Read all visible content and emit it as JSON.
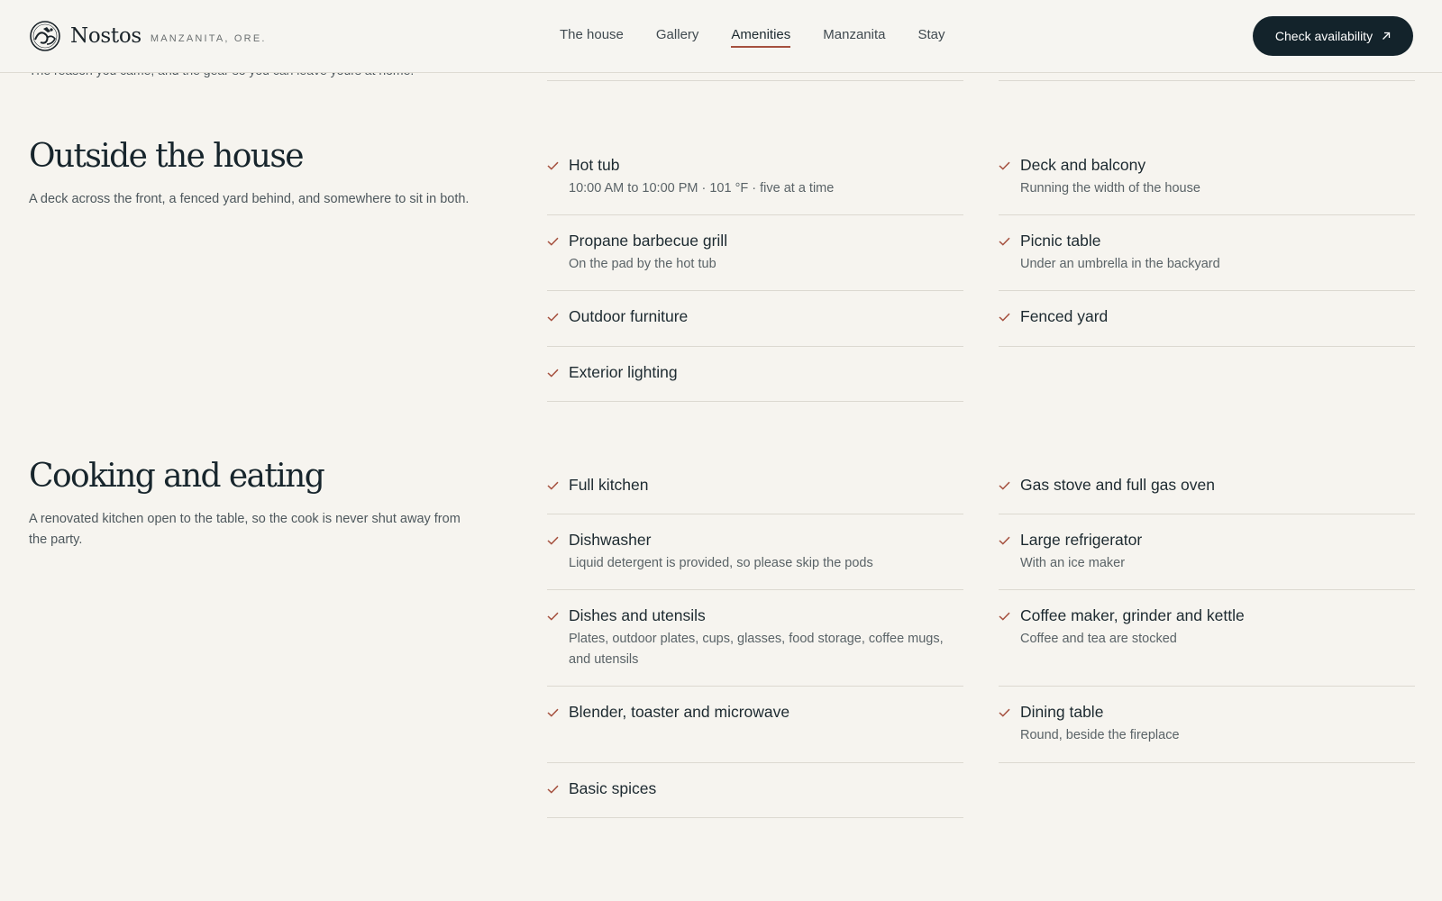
{
  "header": {
    "brand_name": "Nostos",
    "brand_location": "MANZANITA, ORE.",
    "nav": [
      "The house",
      "Gallery",
      "Amenities",
      "Manzanita",
      "Stay"
    ],
    "active_nav": "Amenities",
    "cta_label": "Check availability"
  },
  "previous_section": {
    "description": "The reason you came, and the gear so you can leave yours at home."
  },
  "sections": [
    {
      "title": "Outside the house",
      "description": "A deck across the front, a fenced yard behind, and somewhere to sit in both.",
      "left": [
        {
          "title": "Hot tub",
          "sub": "10:00 AM to 10:00 PM · 101 °F · five at a time"
        },
        {
          "title": "Propane barbecue grill",
          "sub": "On the pad by the hot tub"
        },
        {
          "title": "Outdoor furniture",
          "sub": ""
        },
        {
          "title": "Exterior lighting",
          "sub": ""
        }
      ],
      "right": [
        {
          "title": "Deck and balcony",
          "sub": "Running the width of the house"
        },
        {
          "title": "Picnic table",
          "sub": "Under an umbrella in the backyard"
        },
        {
          "title": "Fenced yard",
          "sub": ""
        }
      ]
    },
    {
      "title": "Cooking and eating",
      "description": "A renovated kitchen open to the table, so the cook is never shut away from the party.",
      "left": [
        {
          "title": "Full kitchen",
          "sub": ""
        },
        {
          "title": "Dishwasher",
          "sub": "Liquid detergent is provided, so please skip the pods"
        },
        {
          "title": "Dishes and utensils",
          "sub": "Plates, outdoor plates, cups, glasses, food storage, coffee mugs, and utensils"
        },
        {
          "title": "Blender, toaster and microwave",
          "sub": ""
        },
        {
          "title": "Basic spices",
          "sub": ""
        }
      ],
      "right": [
        {
          "title": "Gas stove and full gas oven",
          "sub": ""
        },
        {
          "title": "Large refrigerator",
          "sub": "With an ice maker"
        },
        {
          "title": "Coffee maker, grinder and kettle",
          "sub": "Coffee and tea are stocked"
        },
        {
          "title": "Dining table",
          "sub": "Round, beside the fireplace"
        }
      ]
    }
  ],
  "colors": {
    "background": "#f6f4ef",
    "accent": "#a5503e",
    "cta_background": "#13232b",
    "text": "#1d2a30"
  },
  "icons": {
    "logo": "seal-logo-icon",
    "cta": "arrow-up-right-icon",
    "amenity": "check-icon"
  }
}
